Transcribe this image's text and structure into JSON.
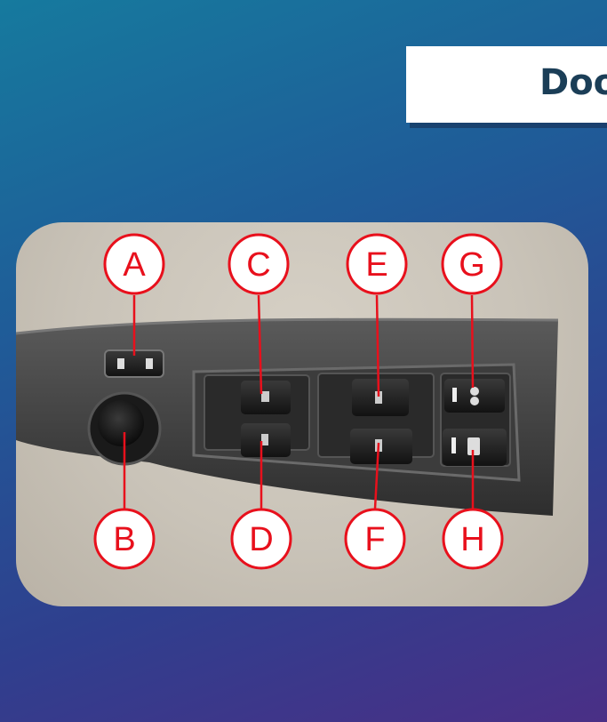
{
  "title": "Doo",
  "callouts": {
    "a": "A",
    "b": "B",
    "c": "C",
    "d": "D",
    "e": "E",
    "f": "F",
    "g": "G",
    "h": "H"
  },
  "colors": {
    "background_start": "#167a9e",
    "background_end": "#4a2f86",
    "title_text": "#1b3e57",
    "callout_red": "#e8101c"
  }
}
